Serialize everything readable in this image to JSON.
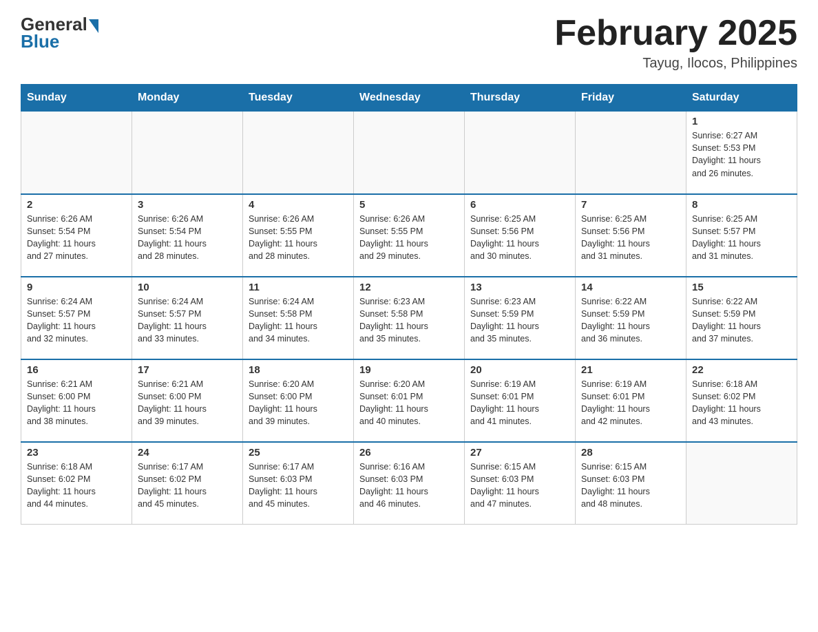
{
  "logo": {
    "general": "General",
    "blue": "Blue"
  },
  "header": {
    "month": "February 2025",
    "location": "Tayug, Ilocos, Philippines"
  },
  "weekdays": [
    "Sunday",
    "Monday",
    "Tuesday",
    "Wednesday",
    "Thursday",
    "Friday",
    "Saturday"
  ],
  "weeks": [
    [
      {
        "day": "",
        "info": ""
      },
      {
        "day": "",
        "info": ""
      },
      {
        "day": "",
        "info": ""
      },
      {
        "day": "",
        "info": ""
      },
      {
        "day": "",
        "info": ""
      },
      {
        "day": "",
        "info": ""
      },
      {
        "day": "1",
        "info": "Sunrise: 6:27 AM\nSunset: 5:53 PM\nDaylight: 11 hours\nand 26 minutes."
      }
    ],
    [
      {
        "day": "2",
        "info": "Sunrise: 6:26 AM\nSunset: 5:54 PM\nDaylight: 11 hours\nand 27 minutes."
      },
      {
        "day": "3",
        "info": "Sunrise: 6:26 AM\nSunset: 5:54 PM\nDaylight: 11 hours\nand 28 minutes."
      },
      {
        "day": "4",
        "info": "Sunrise: 6:26 AM\nSunset: 5:55 PM\nDaylight: 11 hours\nand 28 minutes."
      },
      {
        "day": "5",
        "info": "Sunrise: 6:26 AM\nSunset: 5:55 PM\nDaylight: 11 hours\nand 29 minutes."
      },
      {
        "day": "6",
        "info": "Sunrise: 6:25 AM\nSunset: 5:56 PM\nDaylight: 11 hours\nand 30 minutes."
      },
      {
        "day": "7",
        "info": "Sunrise: 6:25 AM\nSunset: 5:56 PM\nDaylight: 11 hours\nand 31 minutes."
      },
      {
        "day": "8",
        "info": "Sunrise: 6:25 AM\nSunset: 5:57 PM\nDaylight: 11 hours\nand 31 minutes."
      }
    ],
    [
      {
        "day": "9",
        "info": "Sunrise: 6:24 AM\nSunset: 5:57 PM\nDaylight: 11 hours\nand 32 minutes."
      },
      {
        "day": "10",
        "info": "Sunrise: 6:24 AM\nSunset: 5:57 PM\nDaylight: 11 hours\nand 33 minutes."
      },
      {
        "day": "11",
        "info": "Sunrise: 6:24 AM\nSunset: 5:58 PM\nDaylight: 11 hours\nand 34 minutes."
      },
      {
        "day": "12",
        "info": "Sunrise: 6:23 AM\nSunset: 5:58 PM\nDaylight: 11 hours\nand 35 minutes."
      },
      {
        "day": "13",
        "info": "Sunrise: 6:23 AM\nSunset: 5:59 PM\nDaylight: 11 hours\nand 35 minutes."
      },
      {
        "day": "14",
        "info": "Sunrise: 6:22 AM\nSunset: 5:59 PM\nDaylight: 11 hours\nand 36 minutes."
      },
      {
        "day": "15",
        "info": "Sunrise: 6:22 AM\nSunset: 5:59 PM\nDaylight: 11 hours\nand 37 minutes."
      }
    ],
    [
      {
        "day": "16",
        "info": "Sunrise: 6:21 AM\nSunset: 6:00 PM\nDaylight: 11 hours\nand 38 minutes."
      },
      {
        "day": "17",
        "info": "Sunrise: 6:21 AM\nSunset: 6:00 PM\nDaylight: 11 hours\nand 39 minutes."
      },
      {
        "day": "18",
        "info": "Sunrise: 6:20 AM\nSunset: 6:00 PM\nDaylight: 11 hours\nand 39 minutes."
      },
      {
        "day": "19",
        "info": "Sunrise: 6:20 AM\nSunset: 6:01 PM\nDaylight: 11 hours\nand 40 minutes."
      },
      {
        "day": "20",
        "info": "Sunrise: 6:19 AM\nSunset: 6:01 PM\nDaylight: 11 hours\nand 41 minutes."
      },
      {
        "day": "21",
        "info": "Sunrise: 6:19 AM\nSunset: 6:01 PM\nDaylight: 11 hours\nand 42 minutes."
      },
      {
        "day": "22",
        "info": "Sunrise: 6:18 AM\nSunset: 6:02 PM\nDaylight: 11 hours\nand 43 minutes."
      }
    ],
    [
      {
        "day": "23",
        "info": "Sunrise: 6:18 AM\nSunset: 6:02 PM\nDaylight: 11 hours\nand 44 minutes."
      },
      {
        "day": "24",
        "info": "Sunrise: 6:17 AM\nSunset: 6:02 PM\nDaylight: 11 hours\nand 45 minutes."
      },
      {
        "day": "25",
        "info": "Sunrise: 6:17 AM\nSunset: 6:03 PM\nDaylight: 11 hours\nand 45 minutes."
      },
      {
        "day": "26",
        "info": "Sunrise: 6:16 AM\nSunset: 6:03 PM\nDaylight: 11 hours\nand 46 minutes."
      },
      {
        "day": "27",
        "info": "Sunrise: 6:15 AM\nSunset: 6:03 PM\nDaylight: 11 hours\nand 47 minutes."
      },
      {
        "day": "28",
        "info": "Sunrise: 6:15 AM\nSunset: 6:03 PM\nDaylight: 11 hours\nand 48 minutes."
      },
      {
        "day": "",
        "info": ""
      }
    ]
  ]
}
